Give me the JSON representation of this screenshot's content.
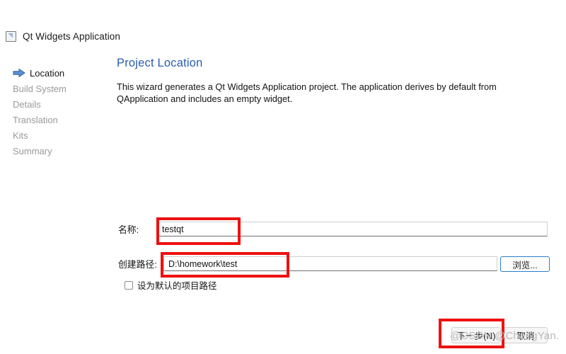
{
  "window": {
    "title": "Qt Widgets Application",
    "icon": "window-icon"
  },
  "sidebar": {
    "items": [
      {
        "label": "Location",
        "current": true
      },
      {
        "label": "Build System",
        "current": false
      },
      {
        "label": "Details",
        "current": false
      },
      {
        "label": "Translation",
        "current": false
      },
      {
        "label": "Kits",
        "current": false
      },
      {
        "label": "Summary",
        "current": false
      }
    ],
    "current_marker_icon": "arrow-right-icon"
  },
  "main": {
    "title": "Project Location",
    "description": "This wizard generates a Qt Widgets Application project. The application derives by default from QApplication and includes an empty widget."
  },
  "form": {
    "name_label": "名称:",
    "name_value": "testqt",
    "name_placeholder": "",
    "path_label": "创建路径:",
    "path_value": "D:\\homework\\test",
    "path_placeholder": "",
    "browse_label": "浏览...",
    "default_path_checkbox_label": "设为默认的项目路径",
    "default_path_checked": false
  },
  "footer": {
    "next_label": "下一步(N)",
    "cancel_label": "取消"
  },
  "watermark": {
    "text": "@CSDN @ChangYan."
  },
  "colors": {
    "title_blue": "#2a5db0",
    "annotation_red": "#ee1111",
    "focus_blue": "#2b7bd1",
    "muted_text": "#9a9a9a"
  }
}
